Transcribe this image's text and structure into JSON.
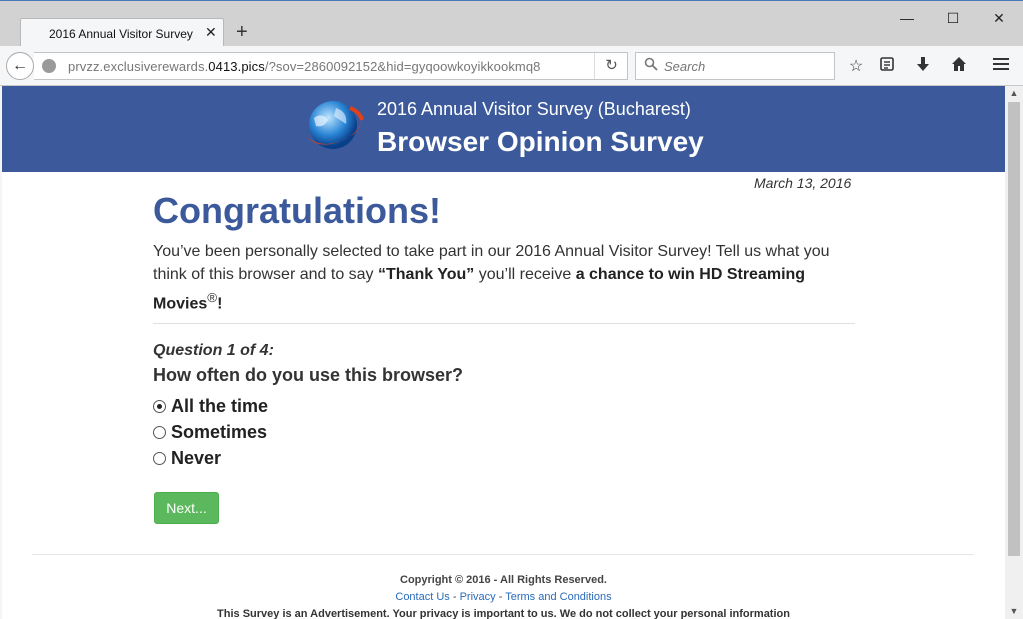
{
  "browser": {
    "tab_title": "2016 Annual Visitor Survey",
    "tab_close": "✕",
    "new_tab": "+",
    "url_prefix": "prvzz.exclusiverewards.",
    "url_domain": "0413.pics",
    "url_suffix": "/?sov=2860092152&hid=gyqoowkoyikkookmq8",
    "search_placeholder": "Search",
    "window_controls": {
      "minimize": "—",
      "maximize": "☐",
      "close": "✕"
    }
  },
  "banner": {
    "subtitle": "2016 Annual Visitor Survey (Bucharest)",
    "title": "Browser Opinion Survey"
  },
  "content": {
    "date": "March 13, 2016",
    "heading": "Congratulations!",
    "intro_1": "You’ve been personally selected to take part in our 2016 Annual Visitor Survey! Tell us what you think of this browser and to say ",
    "intro_thank": "“Thank You”",
    "intro_2": " you’ll receive ",
    "intro_prize": "a chance to win HD Streaming Movies",
    "intro_reg": "®",
    "intro_end": "!",
    "question_number": "Question 1 of 4:",
    "question_text": "How often do you use this browser?",
    "options": [
      {
        "label": "All the time",
        "checked": true
      },
      {
        "label": "Sometimes",
        "checked": false
      },
      {
        "label": "Never",
        "checked": false
      }
    ],
    "next_label": "Next..."
  },
  "footer": {
    "copyright": "Copyright © 2016 - All Rights Reserved.",
    "contact": "Contact Us",
    "privacy": "Privacy",
    "terms": "Terms and Conditions",
    "sep": " - ",
    "disclaimer": "This Survey is an Advertisement. Your privacy is important to us. We do not collect your personal information"
  },
  "colors": {
    "banner": "#3c5a9b",
    "heading": "#3c5a9b",
    "next_button": "#5cb85c",
    "link": "#2a6bb8"
  },
  "icons": [
    "back-arrow-icon",
    "globe-icon",
    "reload-icon",
    "search-icon",
    "bookmark-star-icon",
    "reading-list-icon",
    "download-icon",
    "home-icon",
    "hamburger-menu-icon",
    "browser-logo"
  ]
}
